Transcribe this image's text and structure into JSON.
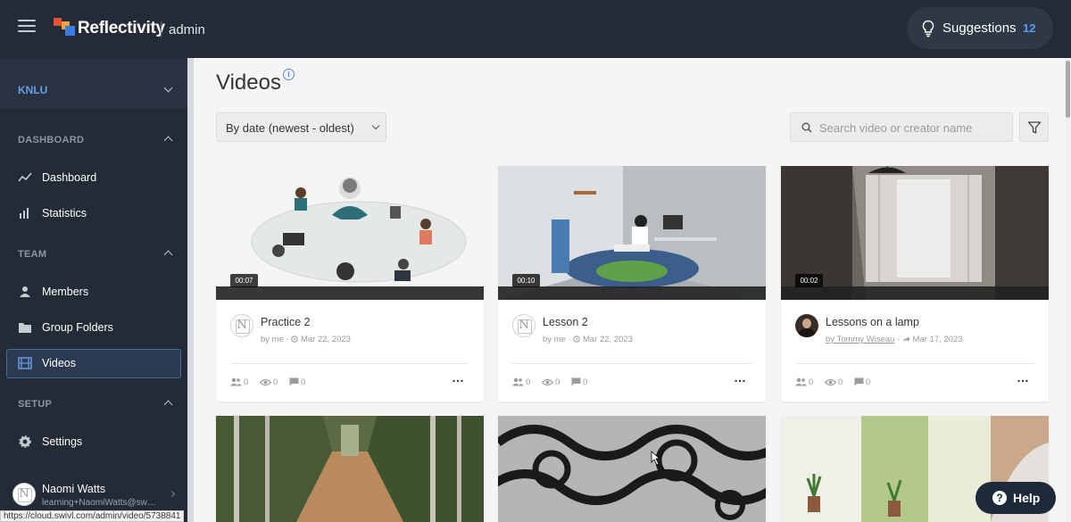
{
  "header": {
    "brand": "Reflectivity",
    "brand_suffix": "admin",
    "suggestions_label": "Suggestions",
    "suggestions_count": "12"
  },
  "sidebar": {
    "org": "KNLU",
    "sections": [
      {
        "label": "DASHBOARD",
        "items": [
          {
            "label": "Dashboard",
            "icon": "trend-line-icon"
          },
          {
            "label": "Statistics",
            "icon": "bar-chart-icon"
          }
        ]
      },
      {
        "label": "TEAM",
        "items": [
          {
            "label": "Members",
            "icon": "person-icon"
          },
          {
            "label": "Group Folders",
            "icon": "folder-icon"
          },
          {
            "label": "Videos",
            "icon": "film-icon",
            "active": true
          }
        ]
      },
      {
        "label": "SETUP",
        "items": [
          {
            "label": "Settings",
            "icon": "gear-icon"
          }
        ]
      }
    ],
    "user": {
      "name": "Naomi Watts",
      "email": "learning+NaomiWatts@swi..."
    }
  },
  "main": {
    "title": "Videos",
    "sort_label": "By date (newest - oldest)",
    "search_placeholder": "Search video or creator name",
    "videos": [
      {
        "title": "Practice 2",
        "creator": "by me",
        "date": "Mar 22, 2023",
        "duration": "00:07",
        "members": "0",
        "views": "0",
        "comments": "0"
      },
      {
        "title": "Lesson 2",
        "creator": "by me",
        "date": "Mar 22, 2023",
        "duration": "00:10",
        "members": "0",
        "views": "0",
        "comments": "0"
      },
      {
        "title": "Lessons on a lamp",
        "creator": "by Tommy Wiseau",
        "date": "Mar 17, 2023",
        "duration": "00:02",
        "members": "0",
        "views": "0",
        "comments": "0"
      }
    ]
  },
  "status_url": "https://cloud.swivl.com/admin/video/5738841",
  "help_label": "Help",
  "colors": {
    "topbar": "#232b36",
    "accent": "#5b9bf0",
    "active_nav": "#2c3b52"
  }
}
